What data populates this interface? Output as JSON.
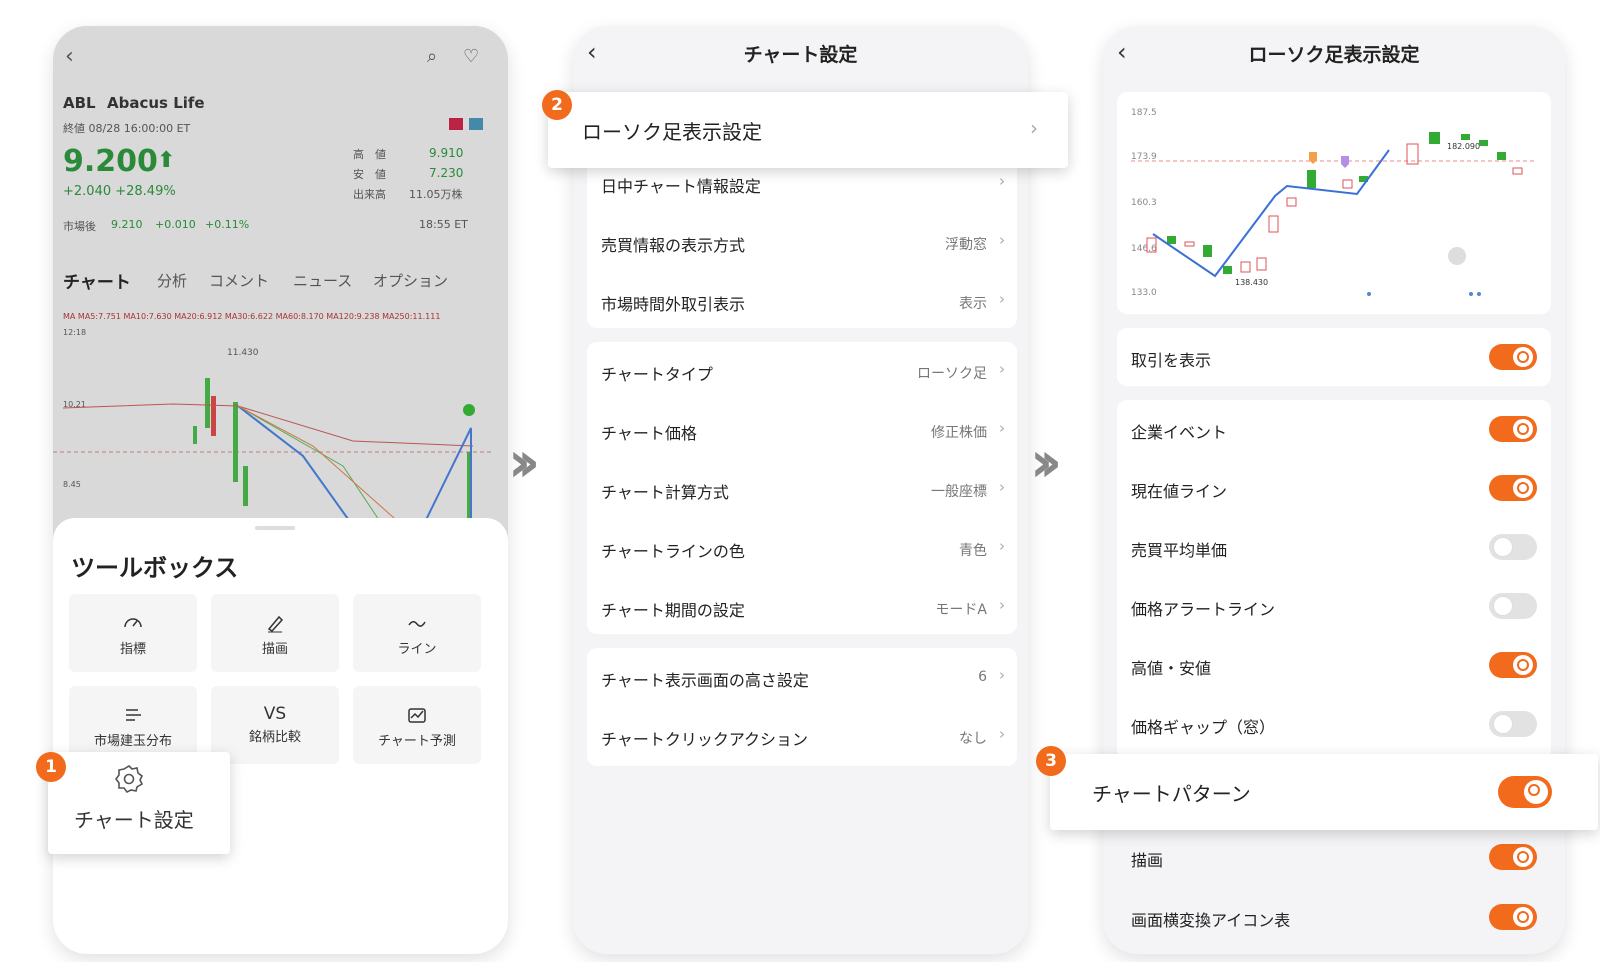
{
  "p1": {
    "ticker": "ABL",
    "name": "Abacus Life",
    "close_label": "終値 08/28 16:00:00 ET",
    "price": "9.200",
    "change": "+2.040 +28.49%",
    "high_label": "高　値",
    "high": "9.910",
    "low_label": "安　値",
    "low": "7.230",
    "vol_label": "出来高",
    "vol": "11.05万株",
    "after_label": "市場後",
    "after_price": "9.210",
    "after_chg": "+0.010",
    "after_pct": "+0.11%",
    "after_time": "18:55 ET",
    "tabs": [
      "チャート",
      "分析",
      "コメント",
      "ニュース",
      "オプション"
    ],
    "ma_line": "MA MA5:7.751 MA10:7.630 MA20:6.912 MA30:6.622 MA60:8.170 MA120:9.238 MA250:11.111",
    "time_label": "12:18",
    "peak": "11.430",
    "low_axis": "8.45",
    "mid_axis": "10.21",
    "toolbox_title": "ツールボックス",
    "tools": [
      "指標",
      "描画",
      "ライン",
      "市場建玉分布",
      "銘柄比較",
      "チャート予測"
    ],
    "vs_text": "VS",
    "chart_setting": "チャート設定"
  },
  "p2": {
    "title": "チャート設定",
    "popup": "ローソク足表示設定",
    "group1": [
      {
        "label": "日中チャート情報設定",
        "value": ""
      },
      {
        "label": "売買情報の表示方式",
        "value": "浮動窓"
      },
      {
        "label": "市場時間外取引表示",
        "value": "表示"
      }
    ],
    "group2": [
      {
        "label": "チャートタイプ",
        "value": "ローソク足"
      },
      {
        "label": "チャート価格",
        "value": "修正株価"
      },
      {
        "label": "チャート計算方式",
        "value": "一般座標"
      },
      {
        "label": "チャートラインの色",
        "value": "青色"
      },
      {
        "label": "チャート期間の設定",
        "value": "モードA"
      }
    ],
    "group3": [
      {
        "label": "チャート表示画面の高さ設定",
        "value": "6"
      },
      {
        "label": "チャートクリックアクション",
        "value": "なし"
      }
    ]
  },
  "p3": {
    "title": "ローソク足表示設定",
    "y_ticks": [
      "187.5",
      "173.9",
      "160.3",
      "146.6",
      "133.0"
    ],
    "hi_label": "182.090",
    "lo_label": "138.430",
    "trade": "取引を表示",
    "toggles": [
      {
        "label": "企業イベント",
        "on": true
      },
      {
        "label": "現在値ライン",
        "on": true
      },
      {
        "label": "売買平均単価",
        "on": false
      },
      {
        "label": "価格アラートライン",
        "on": false
      },
      {
        "label": "高値・安値",
        "on": true
      },
      {
        "label": "価格ギャップ（窓）",
        "on": false
      }
    ],
    "popup": "チャートパターン",
    "below": [
      {
        "label": "描画",
        "on": true
      },
      {
        "label": "画面横変換アイコン表",
        "on": true
      }
    ]
  },
  "badges": [
    "1",
    "2",
    "3"
  ],
  "colors": {
    "accent": "#f26a1b",
    "up": "#2a8a3a",
    "down": "#e04848",
    "line": "#3a6fd8"
  }
}
